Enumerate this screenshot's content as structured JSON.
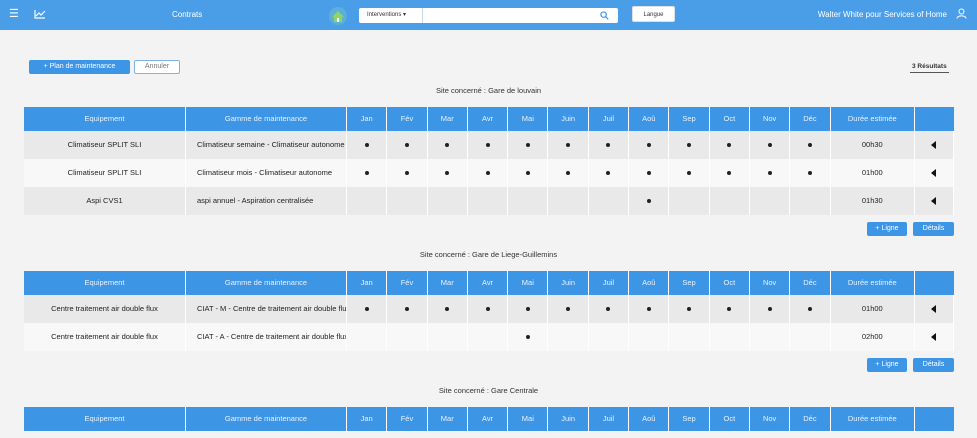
{
  "topbar": {
    "app_title": "Contrats",
    "search_filter": "Interventions",
    "search_placeholder": "",
    "language_button": "Langue",
    "user": "Walter White pour Services of Home"
  },
  "actions": {
    "add_plan": "+ Plan de maintenance",
    "cancel": "Annuler",
    "results": "3 Résultats",
    "add_line": "+ Ligne",
    "details": "Détails"
  },
  "table_headers": {
    "equipement": "Equipement",
    "gamme": "Gamme de maintenance",
    "months": [
      "Jan",
      "Fév",
      "Mar",
      "Avr",
      "Mai",
      "Juin",
      "Juil",
      "Aoû",
      "Sep",
      "Oct",
      "Nov",
      "Déc"
    ],
    "duree": "Durée estimée"
  },
  "sites": [
    {
      "title": "Site concerné : Gare de louvain",
      "rows": [
        {
          "equipement": "Climatiseur SPLIT SLI",
          "gamme": "Climatiseur semaine - Climatiseur autonome",
          "dots": [
            1,
            1,
            1,
            1,
            1,
            1,
            1,
            1,
            1,
            1,
            1,
            1
          ],
          "duree": "00h30"
        },
        {
          "equipement": "Climatiseur SPLIT SLI",
          "gamme": "Climatiseur mois - Climatiseur autonome",
          "dots": [
            1,
            1,
            1,
            1,
            1,
            1,
            1,
            1,
            1,
            1,
            1,
            1
          ],
          "duree": "01h00"
        },
        {
          "equipement": "Aspi CVS1",
          "gamme": "aspi annuel - Aspiration centralisée",
          "dots": [
            0,
            0,
            0,
            0,
            0,
            0,
            0,
            1,
            0,
            0,
            0,
            0
          ],
          "duree": "01h30"
        }
      ]
    },
    {
      "title": "Site concerné : Gare de Liege-Guillemins",
      "rows": [
        {
          "equipement": "Centre traitement air double flux",
          "gamme": "CIAT - M - Centre de traitement air double flux",
          "dots": [
            1,
            1,
            1,
            1,
            1,
            1,
            1,
            1,
            1,
            1,
            1,
            1
          ],
          "duree": "01h00"
        },
        {
          "equipement": "Centre traitement air double flux",
          "gamme": "CIAT - A - Centre de traitement air double flux",
          "dots": [
            0,
            0,
            0,
            0,
            1,
            0,
            0,
            0,
            0,
            0,
            0,
            0
          ],
          "duree": "02h00"
        }
      ]
    },
    {
      "title": "Site concerné : Gare Centrale",
      "rows": []
    }
  ],
  "colors": {
    "primary": "#3d95e6",
    "topbar": "#4a9ee8"
  }
}
